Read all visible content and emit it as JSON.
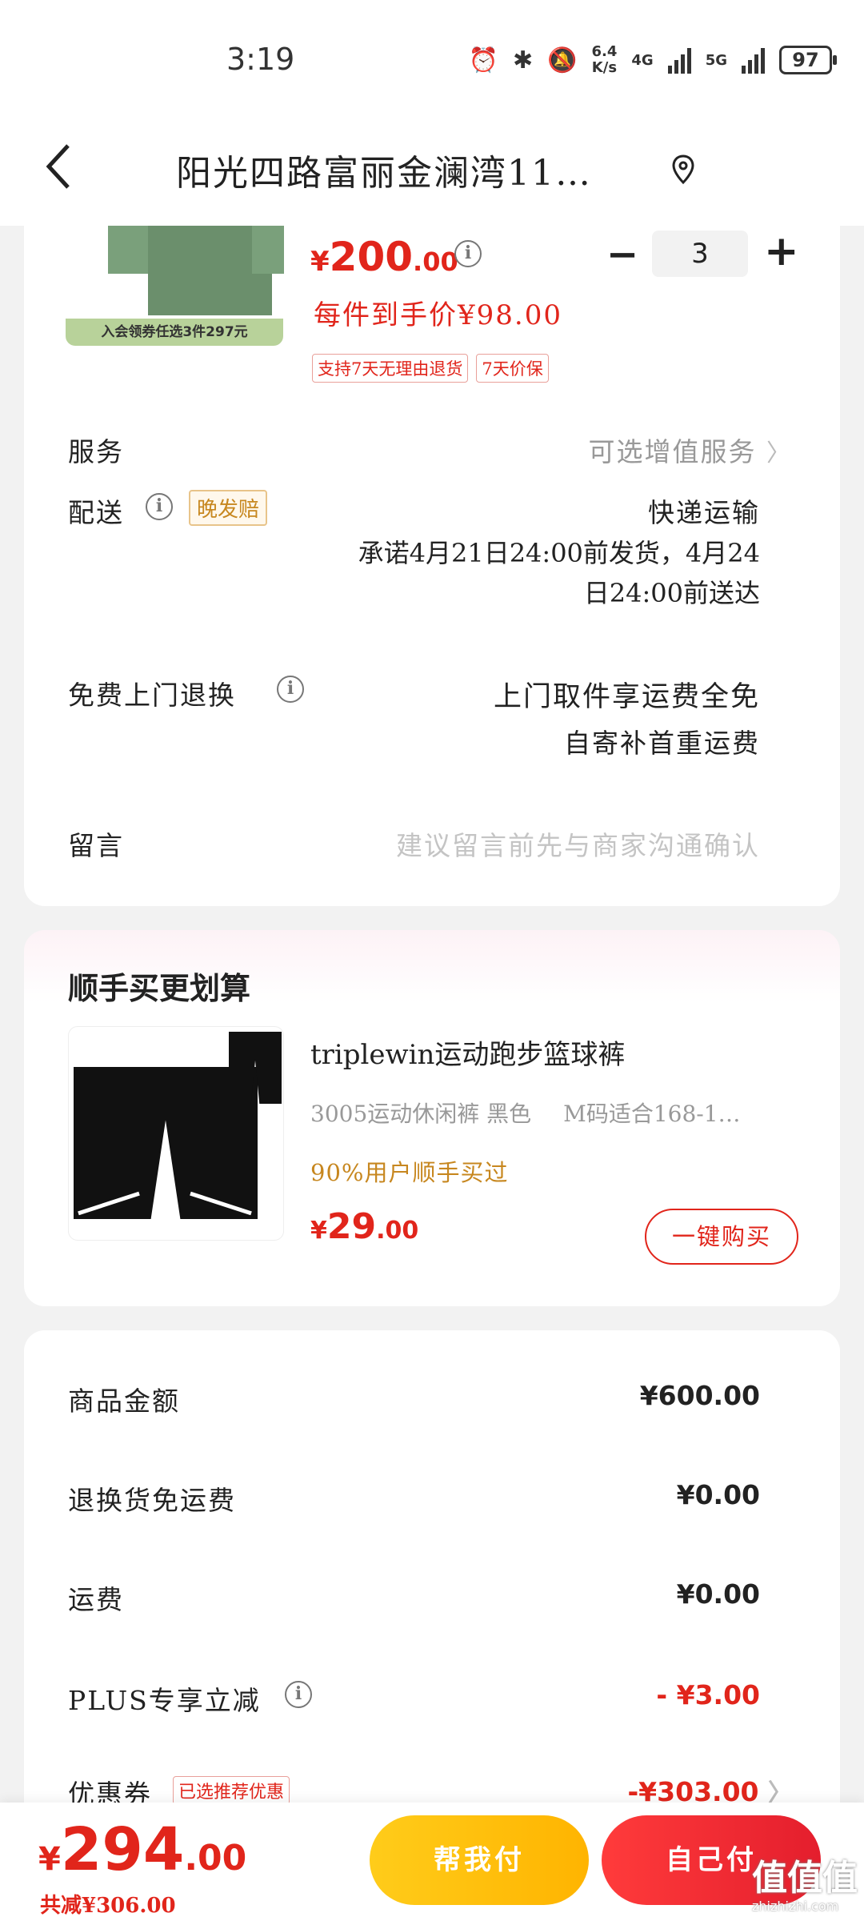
{
  "status_bar": {
    "time": "3:19",
    "net_speed": "6.4",
    "net_speed_unit": "K/s",
    "network_1": "4G",
    "network_2": "5G",
    "battery": "97"
  },
  "header": {
    "back_icon": "chevron-left-icon",
    "title": "阳光四路富丽金澜湾11…",
    "location_icon": "location-pin-icon"
  },
  "product": {
    "promo_strip": "入会领券任选3件297元",
    "price_symbol": "¥",
    "price_int": "200",
    "price_dec": ".00",
    "quantity": "3",
    "minus_label": "−",
    "plus_label": "+",
    "unit_price": "每件到手价¥98.00",
    "tags": [
      "支持7天无理由退货",
      "7天价保"
    ]
  },
  "service": {
    "label": "服务",
    "value": "可选增值服务",
    "chevron": "〉"
  },
  "delivery": {
    "label": "配送",
    "badge": "晚发赔",
    "method": "快递运输",
    "line1": "承诺4月21日24:00前发货，4月24",
    "line2": "日24:00前送达"
  },
  "return": {
    "label": "免费上门退换",
    "value1": "上门取件享运费全免",
    "value2": "自寄补首重运费"
  },
  "message": {
    "label": "留言",
    "placeholder": "建议留言前先与商家沟通确认"
  },
  "addon": {
    "title": "顺手买更划算",
    "product_name": "triplewin运动跑步篮球裤",
    "spec1": "3005运动休闲裤 黑色",
    "spec2": "M码适合168-1…",
    "buyers": "90%用户顺手买过",
    "price_symbol": "¥",
    "price_int": "29",
    "price_dec": ".00",
    "button": "一键购买"
  },
  "summary": {
    "rows": [
      {
        "label": "商品金额",
        "value": "¥600.00"
      },
      {
        "label": "退换货免运费",
        "value": "¥0.00"
      },
      {
        "label": "运费",
        "value": "¥0.00"
      },
      {
        "label": "PLUS专享立减",
        "value": "- ¥3.00"
      },
      {
        "label": "优惠券",
        "value": "-¥303.00"
      }
    ],
    "coupon_tag": "已选推荐优惠"
  },
  "bottom": {
    "price_symbol": "¥",
    "total_int": "294",
    "total_dec": ".00",
    "saved": "共减¥306.00",
    "help_button": "帮我付",
    "self_button": "自己付",
    "watermark": "值值值",
    "watermark_sub": "zhizhizhi.com"
  },
  "colors": {
    "accent": "#e1251b",
    "gold": "#c7871f",
    "yellow_button": "#ffbe00"
  }
}
